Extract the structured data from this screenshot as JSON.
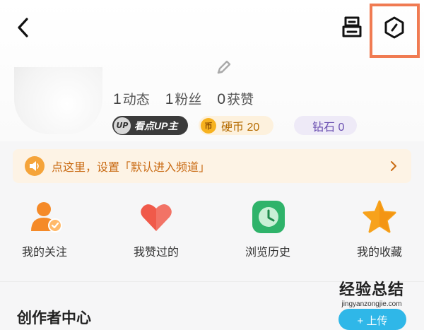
{
  "profile": {
    "stats": [
      {
        "num": "1",
        "label": "动态"
      },
      {
        "num": "1",
        "label": "粉丝"
      },
      {
        "num": "0",
        "label": "获赞"
      }
    ],
    "badges": {
      "up_icon": "UP",
      "up_label": "看点UP主",
      "coin_icon": "币",
      "coin_label": "硬币 20",
      "diamond_label": "钻石 0"
    }
  },
  "notice": {
    "text": "点这里，设置「默认进入频道」"
  },
  "shortcuts": [
    {
      "label": "我的关注",
      "icon": "follow-person-icon"
    },
    {
      "label": "我赞过的",
      "icon": "heart-icon"
    },
    {
      "label": "浏览历史",
      "icon": "clock-icon"
    },
    {
      "label": "我的收藏",
      "icon": "star-icon"
    }
  ],
  "creator": {
    "title": "创作者中心",
    "upload_label": "+ 上传"
  },
  "watermark": {
    "title": "经验总结",
    "url": "jingyanzongjie.com"
  },
  "colors": {
    "highlight_frame": "#f07b52",
    "notice_bg": "#fdf3e5",
    "notice_text": "#c96a12",
    "upload_button": "#2fb7e8"
  }
}
